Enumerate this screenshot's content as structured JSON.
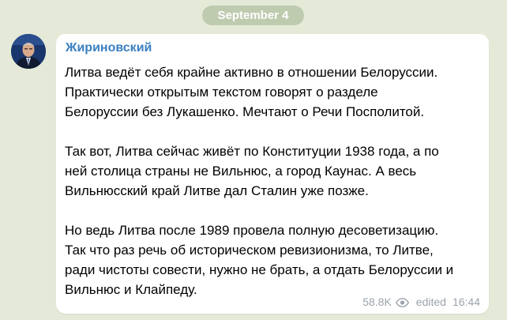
{
  "date_separator": "September 4",
  "post": {
    "sender": "Жириновский",
    "paragraphs": [
      {
        "lines": [
          "Литва ведёт себя крайне активно в отношении Белоруссии.",
          "Практически открытым текстом говорят о разделе",
          "Белоруссии без Лукашенко. Мечтают о Речи Посполитой."
        ]
      },
      {
        "lines": [
          "Так вот, Литва сейчас живёт по Конституции 1938 года, а по",
          "ней столица страны не Вильнюс, а город Каунас. А весь",
          "Вильнюсский край Литве дал Сталин уже позже."
        ]
      },
      {
        "lines": [
          "Но ведь Литва после 1989 провела полную десоветизацию.",
          "Так что раз речь об историческом ревизионизма, то Литве,",
          "ради чистоты совести, нужно не брать, а отдать Белоруссии и",
          "Вильнюс и Клайпеду."
        ]
      }
    ],
    "views": "58.8K",
    "views_icon": "eye-icon",
    "edited_label": "edited",
    "time": "16:44"
  },
  "colors": {
    "background": "#e4ead7",
    "sender_name": "#3a7fc2",
    "meta_text": "#9aa3ab",
    "bubble": "#ffffff"
  }
}
